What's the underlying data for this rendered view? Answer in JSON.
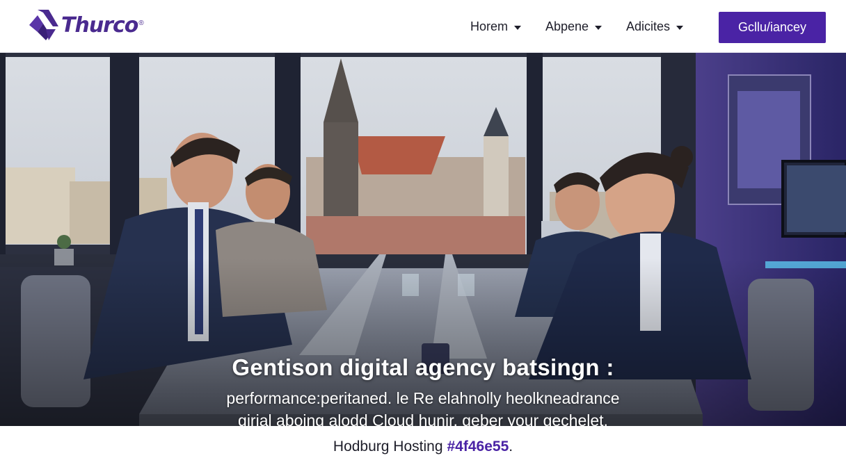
{
  "header": {
    "brand": "Thurco",
    "brand_mark": "®",
    "nav": [
      {
        "label": "Horem"
      },
      {
        "label": "Abpene"
      },
      {
        "label": "Adicites"
      }
    ],
    "cta_label": "Gcllu/iancey"
  },
  "hero": {
    "title": "Gentison digital agency batsingn :",
    "subtitle_line1": "performance:peritaned. le Re elahnolly heolkneadrance",
    "subtitle_line2": "girial aboing alodd Cloud hunir, geber your gechelet."
  },
  "footer": {
    "text": "Hodburg Hosting",
    "accent_text": "#4f46e55",
    "suffix": "."
  },
  "colors": {
    "accent": "#4a23a5",
    "brand": "#4a2a8f"
  },
  "icons": {
    "logo": "thurco-logo-mark-icon",
    "dropdown": "chevron-down-icon"
  }
}
